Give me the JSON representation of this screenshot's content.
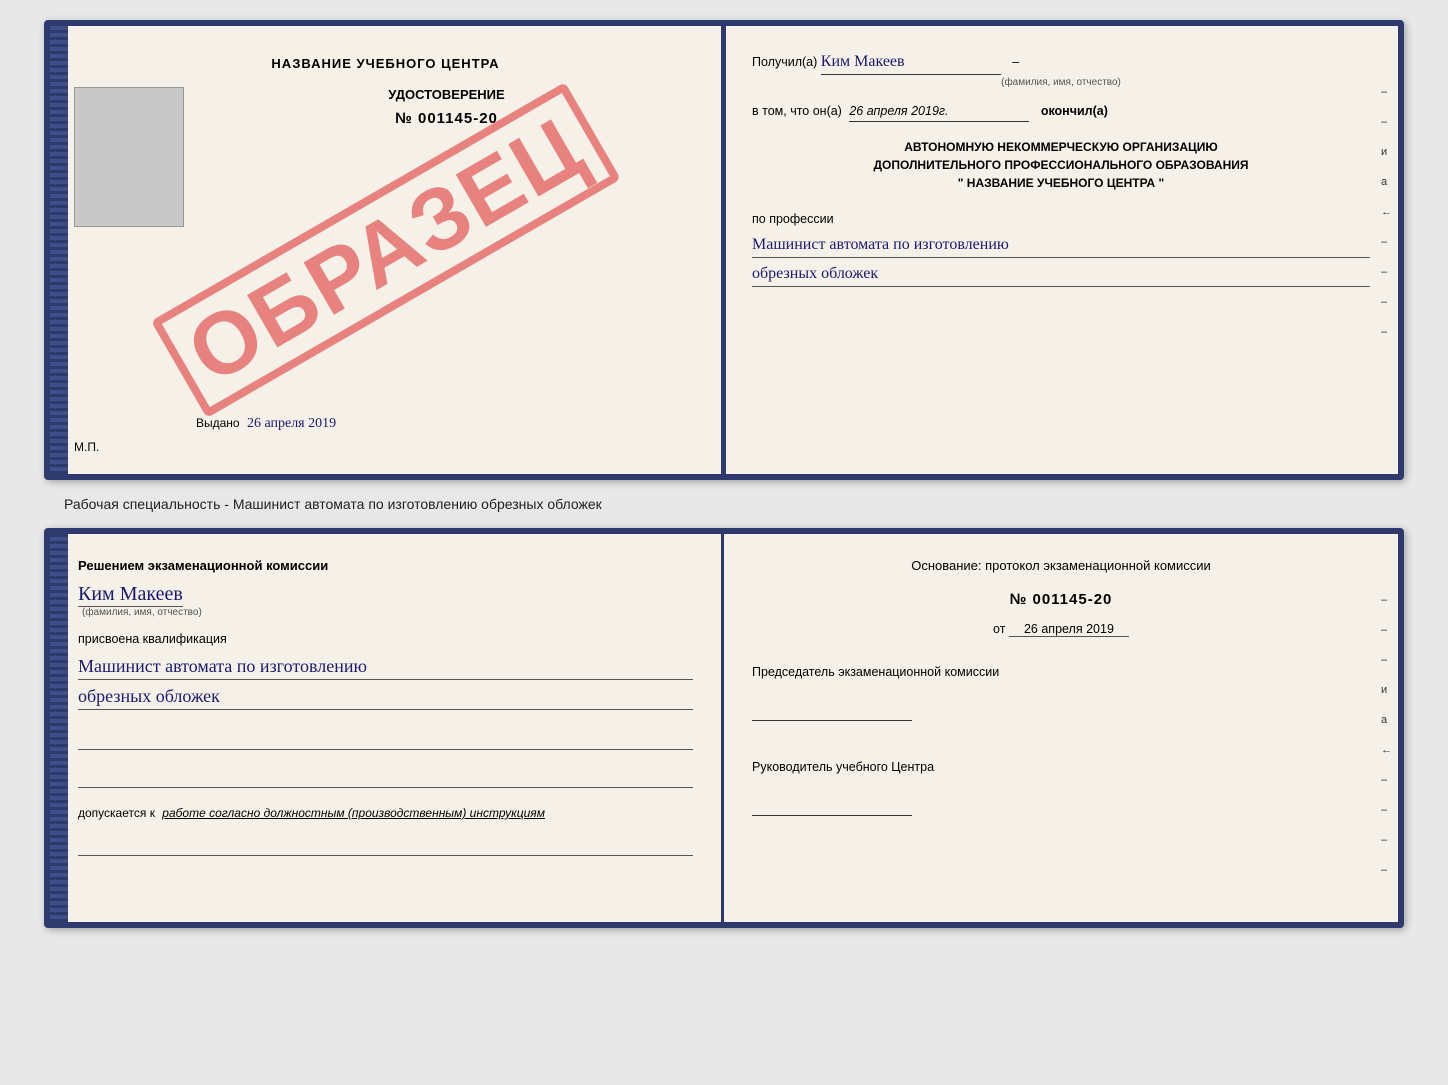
{
  "top_doc": {
    "left": {
      "title": "НАЗВАНИЕ УЧЕБНОГО ЦЕНТРА",
      "cert_type": "УДОСТОВЕРЕНИЕ",
      "cert_number": "№ 001145-20",
      "issued_label": "Выдано",
      "issued_date": "26 апреля 2019",
      "mp_label": "М.П.",
      "watermark": "ОБРАЗЕЦ"
    },
    "right": {
      "received_label": "Получил(а)",
      "recipient_name": "Ким Макеев",
      "fio_label": "(фамилия, имя, отчество)",
      "in_that_label": "в том, что он(а)",
      "completed_date": "26 апреля 2019г.",
      "completed_label": "окончил(а)",
      "org_line1": "АВТОНОМНУЮ НЕКОММЕРЧЕСКУЮ ОРГАНИЗАЦИЮ",
      "org_line2": "ДОПОЛНИТЕЛЬНОГО ПРОФЕССИОНАЛЬНОГО ОБРАЗОВАНИЯ",
      "org_line3": "\"  НАЗВАНИЕ УЧЕБНОГО ЦЕНТРА  \"",
      "profession_label": "по профессии",
      "profession_line1": "Машинист автомата по изготовлению",
      "profession_line2": "обрезных обложек",
      "side_marks": [
        "–",
        "–",
        "и",
        "а",
        "←",
        "–",
        "–",
        "–",
        "–"
      ]
    }
  },
  "caption": "Рабочая специальность - Машинист автомата по изготовлению обрезных обложек",
  "bottom_doc": {
    "left": {
      "decision_label": "Решением экзаменационной комиссии",
      "person_name": "Ким Макеев",
      "fio_label": "(фамилия, имя, отчество)",
      "assigned_label": "присвоена квалификация",
      "qualification_line1": "Машинист автомата по изготовлению",
      "qualification_line2": "обрезных обложек",
      "allowed_label": "допускается к",
      "allowed_text": "работе согласно должностным (производственным) инструкциям"
    },
    "right": {
      "basis_label": "Основание: протокол экзаменационной комиссии",
      "protocol_number": "№  001145-20",
      "date_label": "от",
      "protocol_date": "26 апреля 2019",
      "commission_chair_label": "Председатель экзаменационной комиссии",
      "school_head_label": "Руководитель учебного Центра",
      "side_marks": [
        "–",
        "–",
        "–",
        "и",
        "а",
        "←",
        "–",
        "–",
        "–",
        "–"
      ]
    }
  }
}
